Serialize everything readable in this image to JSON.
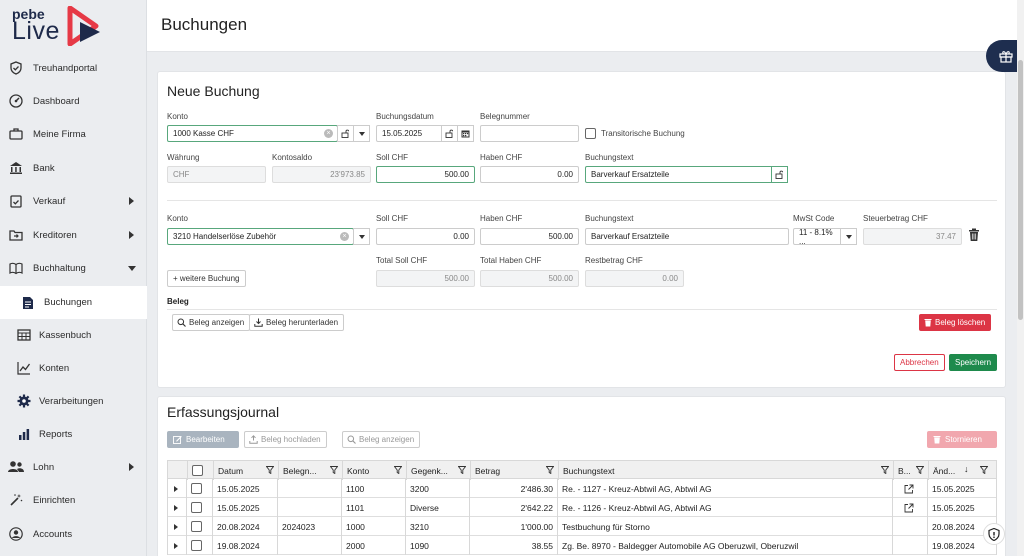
{
  "sidebar": {
    "logo": {
      "top": "pebe",
      "bottom": "Live"
    },
    "items": [
      {
        "label": "Treuhandportal"
      },
      {
        "label": "Dashboard"
      },
      {
        "label": "Meine Firma"
      },
      {
        "label": "Bank"
      },
      {
        "label": "Verkauf"
      },
      {
        "label": "Kreditoren"
      },
      {
        "label": "Buchhaltung"
      },
      {
        "label": "Buchungen"
      },
      {
        "label": "Kassenbuch"
      },
      {
        "label": "Konten"
      },
      {
        "label": "Verarbeitungen"
      },
      {
        "label": "Reports"
      },
      {
        "label": "Lohn"
      },
      {
        "label": "Einrichten"
      },
      {
        "label": "Accounts"
      }
    ]
  },
  "header": {
    "title": "Buchungen"
  },
  "neue_buchung": {
    "title": "Neue Buchung",
    "labels": {
      "konto": "Konto",
      "buchungsdatum": "Buchungsdatum",
      "belegnummer": "Belegnummer",
      "transitorisch": "Transitorische Buchung",
      "waehrung": "Währung",
      "kontosaldo": "Kontosaldo",
      "soll": "Soll CHF",
      "haben": "Haben CHF",
      "buchungstext": "Buchungstext",
      "mwst": "MwSt Code",
      "steuerbetrag": "Steuerbetrag CHF",
      "total_soll": "Total Soll CHF",
      "total_haben": "Total Haben CHF",
      "restbetrag": "Restbetrag CHF",
      "beleg": "Beleg"
    },
    "row1": {
      "konto": "1000 Kasse CHF",
      "datum": "15.05.2025",
      "belegnummer": "",
      "waehrung": "CHF",
      "kontosaldo": "23'973.85",
      "soll": "500.00",
      "haben": "0.00",
      "buchungstext": "Barverkauf Ersatzteile"
    },
    "row2": {
      "konto": "3210 Handelserlöse Zubehör",
      "soll": "0.00",
      "haben": "500.00",
      "buchungstext": "Barverkauf Ersatzteile",
      "mwst": "11 - 8.1% ...",
      "steuerbetrag": "37.47"
    },
    "totals": {
      "soll": "500.00",
      "haben": "500.00",
      "rest": "0.00"
    },
    "buttons": {
      "weitere": "+ weitere Buchung",
      "beleg_anzeigen": "Beleg anzeigen",
      "beleg_herunterladen": "Beleg herunterladen",
      "beleg_loeschen": "Beleg löschen",
      "abbrechen": "Abbrechen",
      "speichern": "Speichern"
    }
  },
  "journal": {
    "title": "Erfassungsjournal",
    "buttons": {
      "bearbeiten": "Bearbeiten",
      "hochladen": "Beleg hochladen",
      "anzeigen": "Beleg anzeigen",
      "stornieren": "Stornieren"
    },
    "columns": [
      "Datum",
      "Belegn...",
      "Konto",
      "Gegenk...",
      "Betrag",
      "Buchungstext",
      "B...",
      "Änd..."
    ],
    "rows": [
      {
        "datum": "15.05.2025",
        "beleg": "",
        "konto": "1100",
        "gegenkonto": "3200",
        "betrag": "2'486.30",
        "text": "Re. - 1127 - Kreuz-Abtwil AG, Abtwil AG",
        "link": true,
        "aend": "15.05.2025"
      },
      {
        "datum": "15.05.2025",
        "beleg": "",
        "konto": "1101",
        "gegenkonto": "Diverse",
        "betrag": "2'642.22",
        "text": "Re. - 1126 - Kreuz-Abtwil AG, Abtwil AG",
        "link": true,
        "aend": "15.05.2025"
      },
      {
        "datum": "20.08.2024",
        "beleg": "2024023",
        "konto": "1000",
        "gegenkonto": "3210",
        "betrag": "1'000.00",
        "text": "Testbuchung für Storno",
        "link": false,
        "aend": "20.08.2024"
      },
      {
        "datum": "19.08.2024",
        "beleg": "",
        "konto": "2000",
        "gegenkonto": "1090",
        "betrag": "38.55",
        "text": "Zg. Be. 8970 - Baldegger Automobile AG Oberuzwil, Oberuzwil",
        "link": false,
        "aend": "19.08.2024"
      }
    ]
  }
}
